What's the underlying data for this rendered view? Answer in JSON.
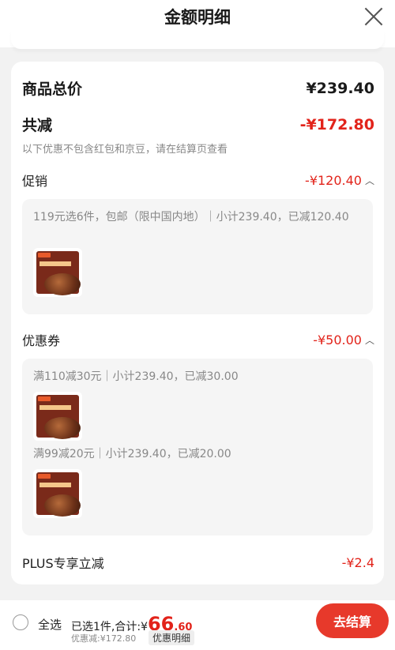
{
  "header": {
    "title": "金额明细"
  },
  "summary": {
    "total_label": "商品总价",
    "total_value": "¥239.40",
    "reduce_label": "共减",
    "reduce_value": "-¥172.80",
    "note": "以下优惠不包含红包和京豆，请在结算页查看"
  },
  "promotion": {
    "label": "促销",
    "value": "-¥120.40",
    "items": [
      {
        "text": "119元选6件，包邮（限中国内地）｜小计239.40，已减120.40"
      }
    ]
  },
  "coupon": {
    "label": "优惠券",
    "value": "-¥50.00",
    "items": [
      {
        "text": "满110减30元｜小计239.40，已减30.00"
      },
      {
        "text": "满99减20元｜小计239.40，已减20.00"
      }
    ]
  },
  "plus": {
    "label": "PLUS专享立减",
    "value": "-¥2.4"
  },
  "footer": {
    "select_all": "全选",
    "selected_prefix": "已选1件,合计:¥",
    "total_int": "66",
    "total_dec": ".60",
    "discount_text": "优惠减:¥172.80",
    "detail_tag": "优惠明细",
    "checkout": "去结算"
  },
  "colors": {
    "accent": "#e2231a",
    "background": "#f2f2f2"
  },
  "icons": {
    "close": "close-icon",
    "chevron": "chevron-up-icon"
  }
}
